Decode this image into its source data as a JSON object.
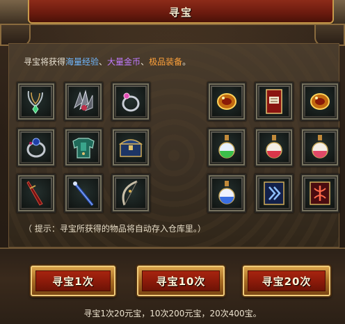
{
  "window": {
    "title": "寻宝"
  },
  "intro": {
    "prefix": "寻宝将获得",
    "exp": "海量经验",
    "sep1": "、",
    "gold": "大量金币",
    "sep2": "、",
    "equip": "极品装备",
    "suffix": "。"
  },
  "hint": "（ 提示：寻宝所获得的物品将自动存入仓库里。）",
  "buttons": {
    "once": "寻宝1次",
    "ten": "寻宝10次",
    "twenty": "寻宝20次"
  },
  "price_text": "寻宝1次20元宝，10次200元宝，20次400宝。",
  "colors": {
    "exp": "#6fb8ff",
    "gold": "#c07bff",
    "equip": "#ffa23a"
  },
  "items_left": [
    "necklace-icon",
    "wing-pauldron-icon",
    "ring-pink-gem-icon",
    "ring-blue-gem-icon",
    "jade-armor-icon",
    "treasure-chest-icon",
    "red-sword-icon",
    "blue-staff-icon",
    "bow-icon"
  ],
  "items_right": [
    "gold-orb-icon",
    "red-book-icon",
    "gold-orb-icon",
    "green-potion-icon",
    "red-potion-icon",
    "red-potion-icon",
    "blue-potion-icon",
    "rune-scroll-blue-icon",
    "rune-scroll-red-icon"
  ]
}
